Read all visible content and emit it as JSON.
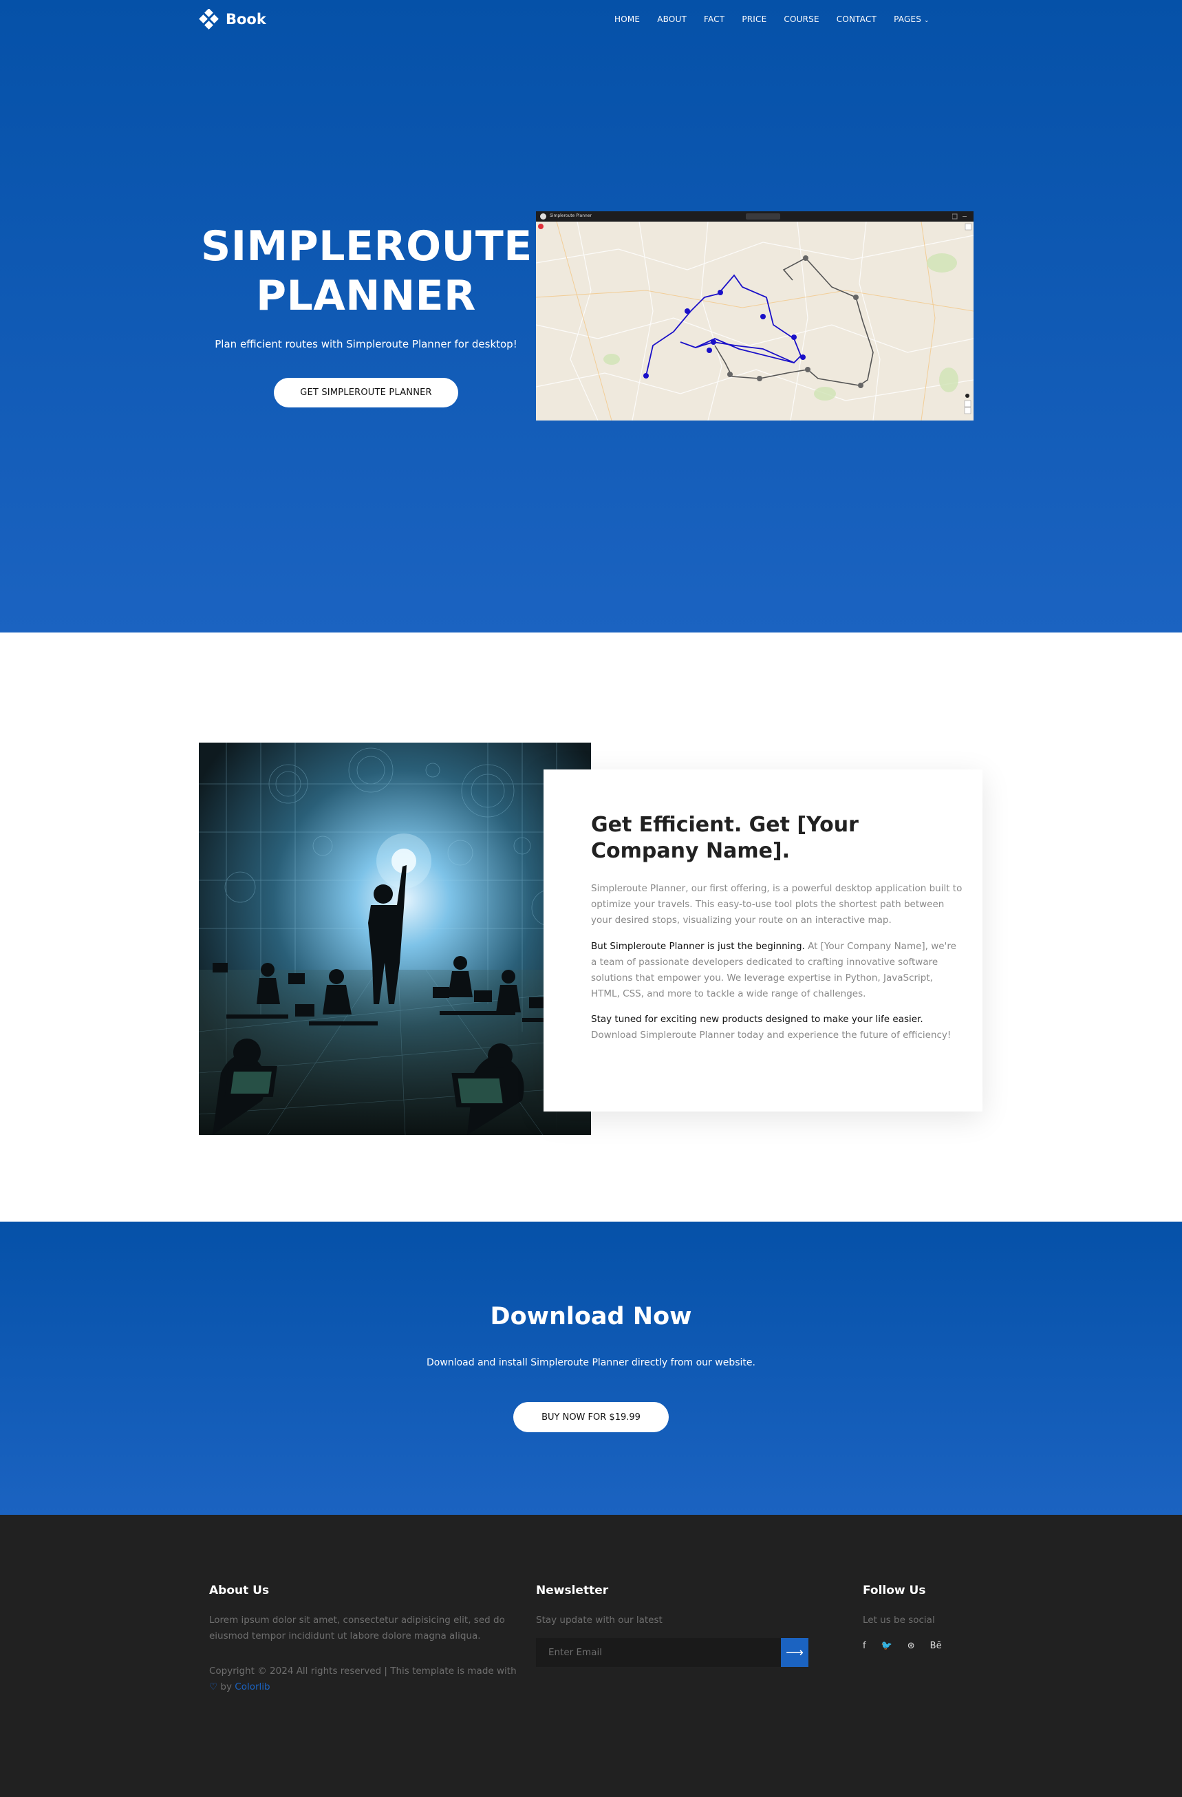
{
  "nav": {
    "brand": "Book",
    "links": [
      "HOME",
      "ABOUT",
      "FACT",
      "PRICE",
      "COURSE",
      "CONTACT",
      "PAGES"
    ]
  },
  "hero": {
    "title_line1": "SIMPLEROUTE",
    "title_line2": "PLANNER",
    "subtitle": "Plan efficient routes with Simpleroute Planner for desktop!",
    "button": "GET SIMPLEROUTE PLANNER",
    "app_window_title": "Simpleroute Planner"
  },
  "about": {
    "title": "Get Efficient. Get [Your Company Name].",
    "p1": "Simpleroute Planner, our first offering, is a powerful desktop application built to optimize your travels. This easy-to-use tool plots the shortest path between your desired stops, visualizing your route on an interactive map.",
    "p2_strong": "But Simpleroute Planner is just the beginning.",
    "p2_rest": " At [Your Company Name], we're a team of passionate developers dedicated to crafting innovative software solutions that empower you. We leverage expertise in Python, JavaScript, HTML, CSS, and more to tackle a wide range of challenges.",
    "p3_strong": "Stay tuned for exciting new products designed to make your life easier.",
    "p3_rest": " Download Simpleroute Planner today and experience the future of efficiency!"
  },
  "download": {
    "title": "Download Now",
    "subtitle": "Download and install Simpleroute Planner directly from our website.",
    "button": "BUY NOW FOR $19.99"
  },
  "footer": {
    "about_title": "About Us",
    "about_text": "Lorem ipsum dolor sit amet, consectetur adipisicing elit, sed do eiusmod tempor incididunt ut labore dolore magna aliqua.",
    "copyright_pre": "Copyright © 2024 All rights reserved | This template is made with",
    "copyright_by": " by ",
    "copyright_link": "Colorlib",
    "newsletter_title": "Newsletter",
    "newsletter_text": "Stay update with our latest",
    "newsletter_placeholder": "Enter Email",
    "follow_title": "Follow Us",
    "follow_text": "Let us be social",
    "social": [
      "f",
      "🐦",
      "⊛",
      "Bē"
    ]
  },
  "colors": {
    "primary": "#0551a8",
    "primary_light": "#1b63c1",
    "footer_bg": "#212121"
  }
}
